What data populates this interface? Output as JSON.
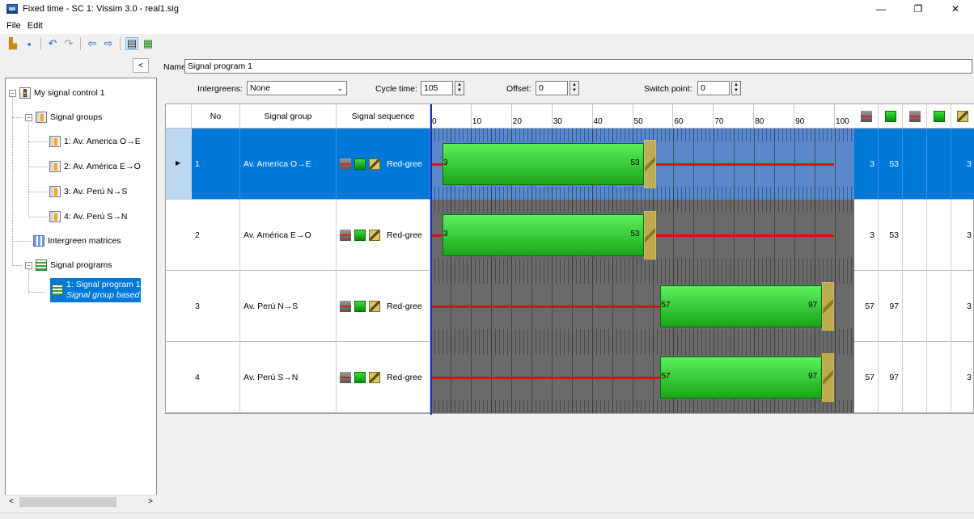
{
  "window": {
    "title": "Fixed time - SC 1: Vissim 3.0 - real1.sig"
  },
  "menu": [
    {
      "label": "File"
    },
    {
      "label": "Edit"
    }
  ],
  "tree": {
    "root": "My signal control 1",
    "signal_groups_label": "Signal groups",
    "signal_groups": [
      "1: Av. America O→E",
      "2: Av. América E→O",
      "3: Av. Perú N→S",
      "4: Av. Perú S→N"
    ],
    "intergreen_label": "Intergreen matrices",
    "programs_label": "Signal programs",
    "program_item": "1: Signal program 1",
    "program_item_sub": "Signal group based"
  },
  "form": {
    "name_label": "Name:",
    "name_value": "Signal program 1",
    "intergreens_label": "Intergreens:",
    "intergreens_value": "None",
    "cycle_label": "Cycle time:",
    "cycle_value": "105",
    "offset_label": "Offset:",
    "offset_value": "0",
    "switch_label": "Switch point:",
    "switch_value": "0"
  },
  "grid": {
    "headers": {
      "no": "No",
      "group": "Signal group",
      "sequence": "Signal sequence"
    },
    "scale": [
      "0",
      "10",
      "20",
      "30",
      "40",
      "50",
      "60",
      "70",
      "80",
      "90",
      "100"
    ],
    "rows": [
      {
        "no": "1",
        "group": "Av. America O→E",
        "sequence": "Red-gree",
        "green_start": 3,
        "green_end": 53,
        "start_label": "3",
        "end_label": "53",
        "c1": "3",
        "c2": "53",
        "c3": "3",
        "selected": true
      },
      {
        "no": "2",
        "group": "Av. América E→O",
        "sequence": "Red-gree",
        "green_start": 3,
        "green_end": 53,
        "start_label": "3",
        "end_label": "53",
        "c1": "3",
        "c2": "53",
        "c3": "3",
        "selected": false
      },
      {
        "no": "3",
        "group": "Av. Perú N→S",
        "sequence": "Red-gree",
        "green_start": 57,
        "green_end": 97,
        "start_label": "57",
        "end_label": "97",
        "c1": "57",
        "c2": "97",
        "c3": "3",
        "selected": false
      },
      {
        "no": "4",
        "group": "Av. Perú S→N",
        "sequence": "Red-gree",
        "green_start": 57,
        "green_end": 97,
        "start_label": "57",
        "end_label": "97",
        "c1": "57",
        "c2": "97",
        "c3": "3",
        "selected": false
      }
    ],
    "cycle": 105,
    "amber_duration": 3
  },
  "colors": {
    "selection": "#0078d7",
    "green": "#1aa51a",
    "red": "#e01010"
  }
}
